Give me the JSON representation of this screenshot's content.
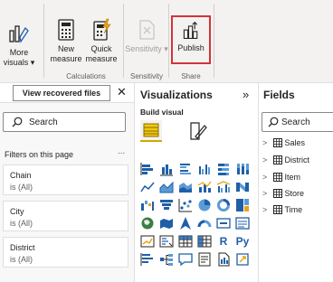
{
  "ribbon": {
    "more_visuals": {
      "line1": "More",
      "line2": "visuals",
      "chevron": "▾"
    },
    "new_measure": {
      "line1": "New",
      "line2": "measure"
    },
    "quick_measure": {
      "line1": "Quick",
      "line2": "measure"
    },
    "sensitivity": {
      "label": "Sensitivity",
      "chevron": "▾"
    },
    "publish": {
      "label": "Publish"
    },
    "groups": {
      "calculations": "Calculations",
      "sensitivity": "Sensitivity",
      "share": "Share"
    }
  },
  "filters_pane": {
    "recover_button": "View recovered files",
    "close_glyph": "✕",
    "search_placeholder": "Search",
    "section_title": "Filters on this page",
    "more_glyph": "...",
    "cards": [
      {
        "title": "Chain",
        "state": "is (All)"
      },
      {
        "title": "City",
        "state": "is (All)"
      },
      {
        "title": "District",
        "state": "is (All)"
      }
    ]
  },
  "visualizations_pane": {
    "title": "Visualizations",
    "collapse_glyph": "»",
    "build_visual": "Build visual",
    "text_icons": {
      "r_visual": "R",
      "py_visual": "Py"
    }
  },
  "fields_pane": {
    "title": "Fields",
    "search_placeholder": "Search",
    "tables": [
      "Sales",
      "District",
      "Item",
      "Store",
      "Time"
    ],
    "chevron": ">"
  },
  "colors": {
    "accent_yellow": "#d4a800",
    "publish_highlight": "#d13438",
    "viz_blue": "#1f5fa8"
  }
}
